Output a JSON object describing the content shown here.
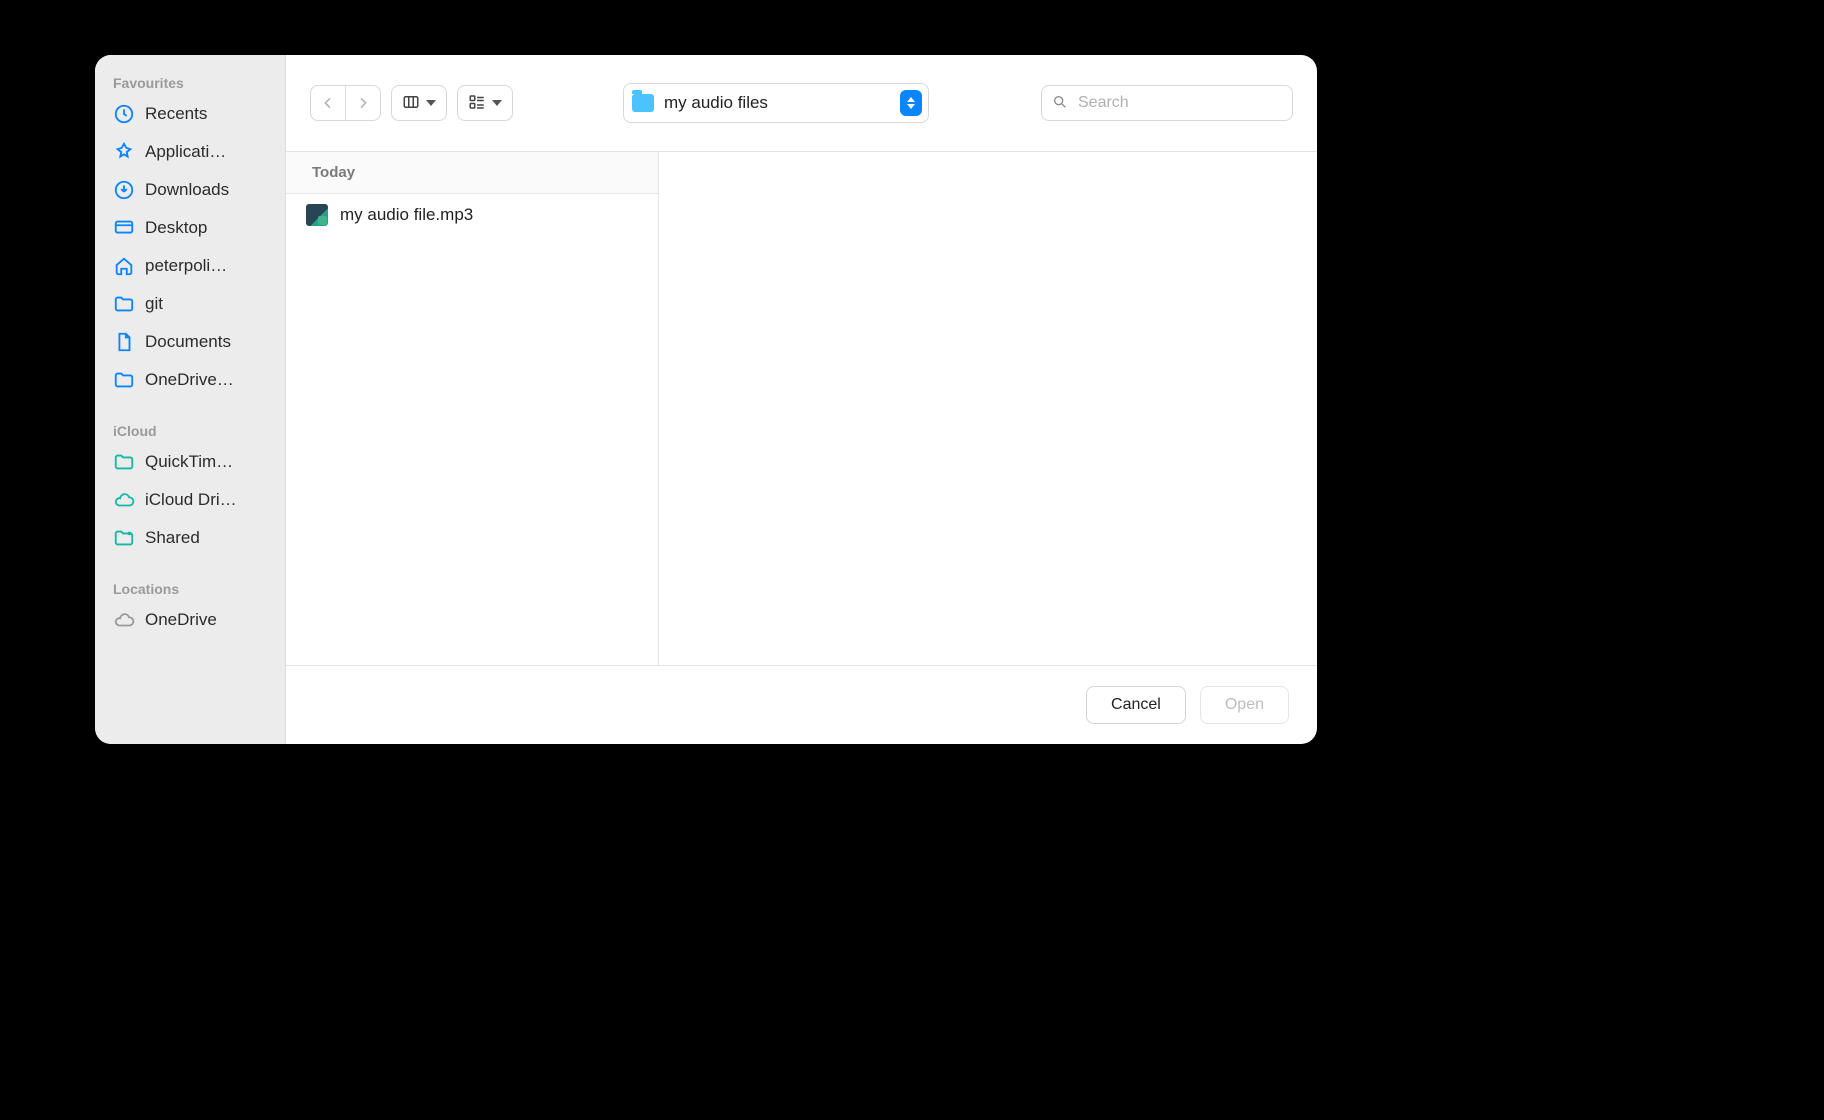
{
  "sidebar": {
    "sections": [
      {
        "title": "Favourites",
        "items": [
          {
            "icon": "clock",
            "label": "Recents",
            "color": "#0a84ff"
          },
          {
            "icon": "apps",
            "label": "Applicati…",
            "color": "#0a84ff"
          },
          {
            "icon": "download",
            "label": "Downloads",
            "color": "#0a84ff"
          },
          {
            "icon": "desktop",
            "label": "Desktop",
            "color": "#0a84ff"
          },
          {
            "icon": "home",
            "label": "peterpoli…",
            "color": "#0a84ff"
          },
          {
            "icon": "folder",
            "label": "git",
            "color": "#0a84ff"
          },
          {
            "icon": "document",
            "label": "Documents",
            "color": "#0a84ff"
          },
          {
            "icon": "folder",
            "label": "OneDrive…",
            "color": "#0a84ff"
          }
        ]
      },
      {
        "title": "iCloud",
        "items": [
          {
            "icon": "folder",
            "label": "QuickTim…",
            "color": "#14b8a6"
          },
          {
            "icon": "cloud",
            "label": "iCloud Dri…",
            "color": "#14b8a6"
          },
          {
            "icon": "folder-dot",
            "label": "Shared",
            "color": "#14b8a6"
          }
        ]
      },
      {
        "title": "Locations",
        "items": [
          {
            "icon": "cloud",
            "label": "OneDrive",
            "color": "#9a9a9a"
          }
        ]
      }
    ]
  },
  "toolbar": {
    "current_folder": "my audio files",
    "search_placeholder": "Search"
  },
  "column": {
    "group_header": "Today",
    "files": [
      {
        "name": "my audio file.mp3"
      }
    ]
  },
  "footer": {
    "cancel_label": "Cancel",
    "open_label": "Open",
    "open_enabled": false
  }
}
